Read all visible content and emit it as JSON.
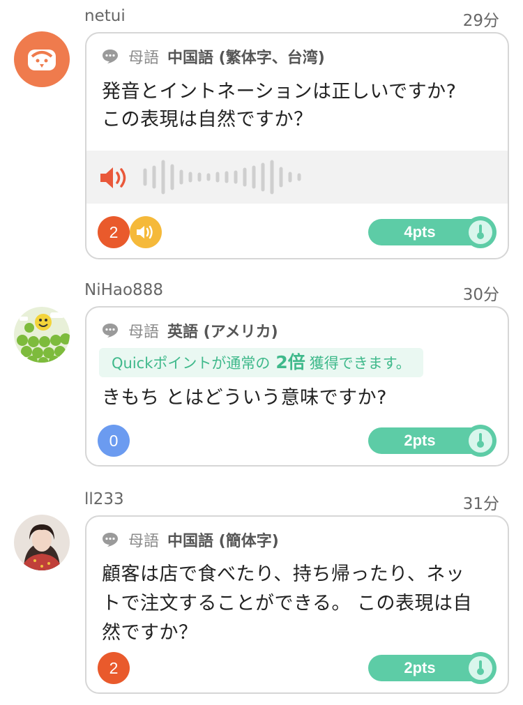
{
  "posts": [
    {
      "username": "netui",
      "time": "29分",
      "lang_prefix": "母語",
      "lang_name": "中国語 (繁体字、台湾)",
      "question_lines": [
        "発音とイントネーションは正しいですか?",
        "この表現は自然ですか？"
      ],
      "answer_count": "2",
      "points": "4pts"
    },
    {
      "username": "NiHao888",
      "time": "30分",
      "lang_prefix": "母語",
      "lang_name": "英語 (アメリカ)",
      "quick_banner": {
        "before": "Quickポイントが通常の",
        "multiplier": "2倍",
        "after": "獲得できます。"
      },
      "question_lines": [
        "きもち とはどういう意味ですか?"
      ],
      "answer_count": "0",
      "points": "2pts"
    },
    {
      "username": "ll233",
      "time": "31分",
      "lang_prefix": "母語",
      "lang_name": "中国語 (簡体字)",
      "question_lines": [
        "顧客は店で食べたり、持ち帰ったり、ネッ",
        "トで注文することができる。 この表現は自",
        "然ですか？"
      ],
      "answer_count": "2",
      "points": "2pts"
    }
  ],
  "colors": {
    "accent_green": "#5dcca6",
    "answer_orange": "#e95a2c",
    "answer_blue": "#6b9bf0",
    "audio_yellow": "#f5b93a",
    "speaker_red": "#e9583a"
  },
  "icons": [
    "speech-bubble-icon",
    "speaker-icon",
    "waveform-icon",
    "audio-answer-icon",
    "points-toggle-icon"
  ]
}
